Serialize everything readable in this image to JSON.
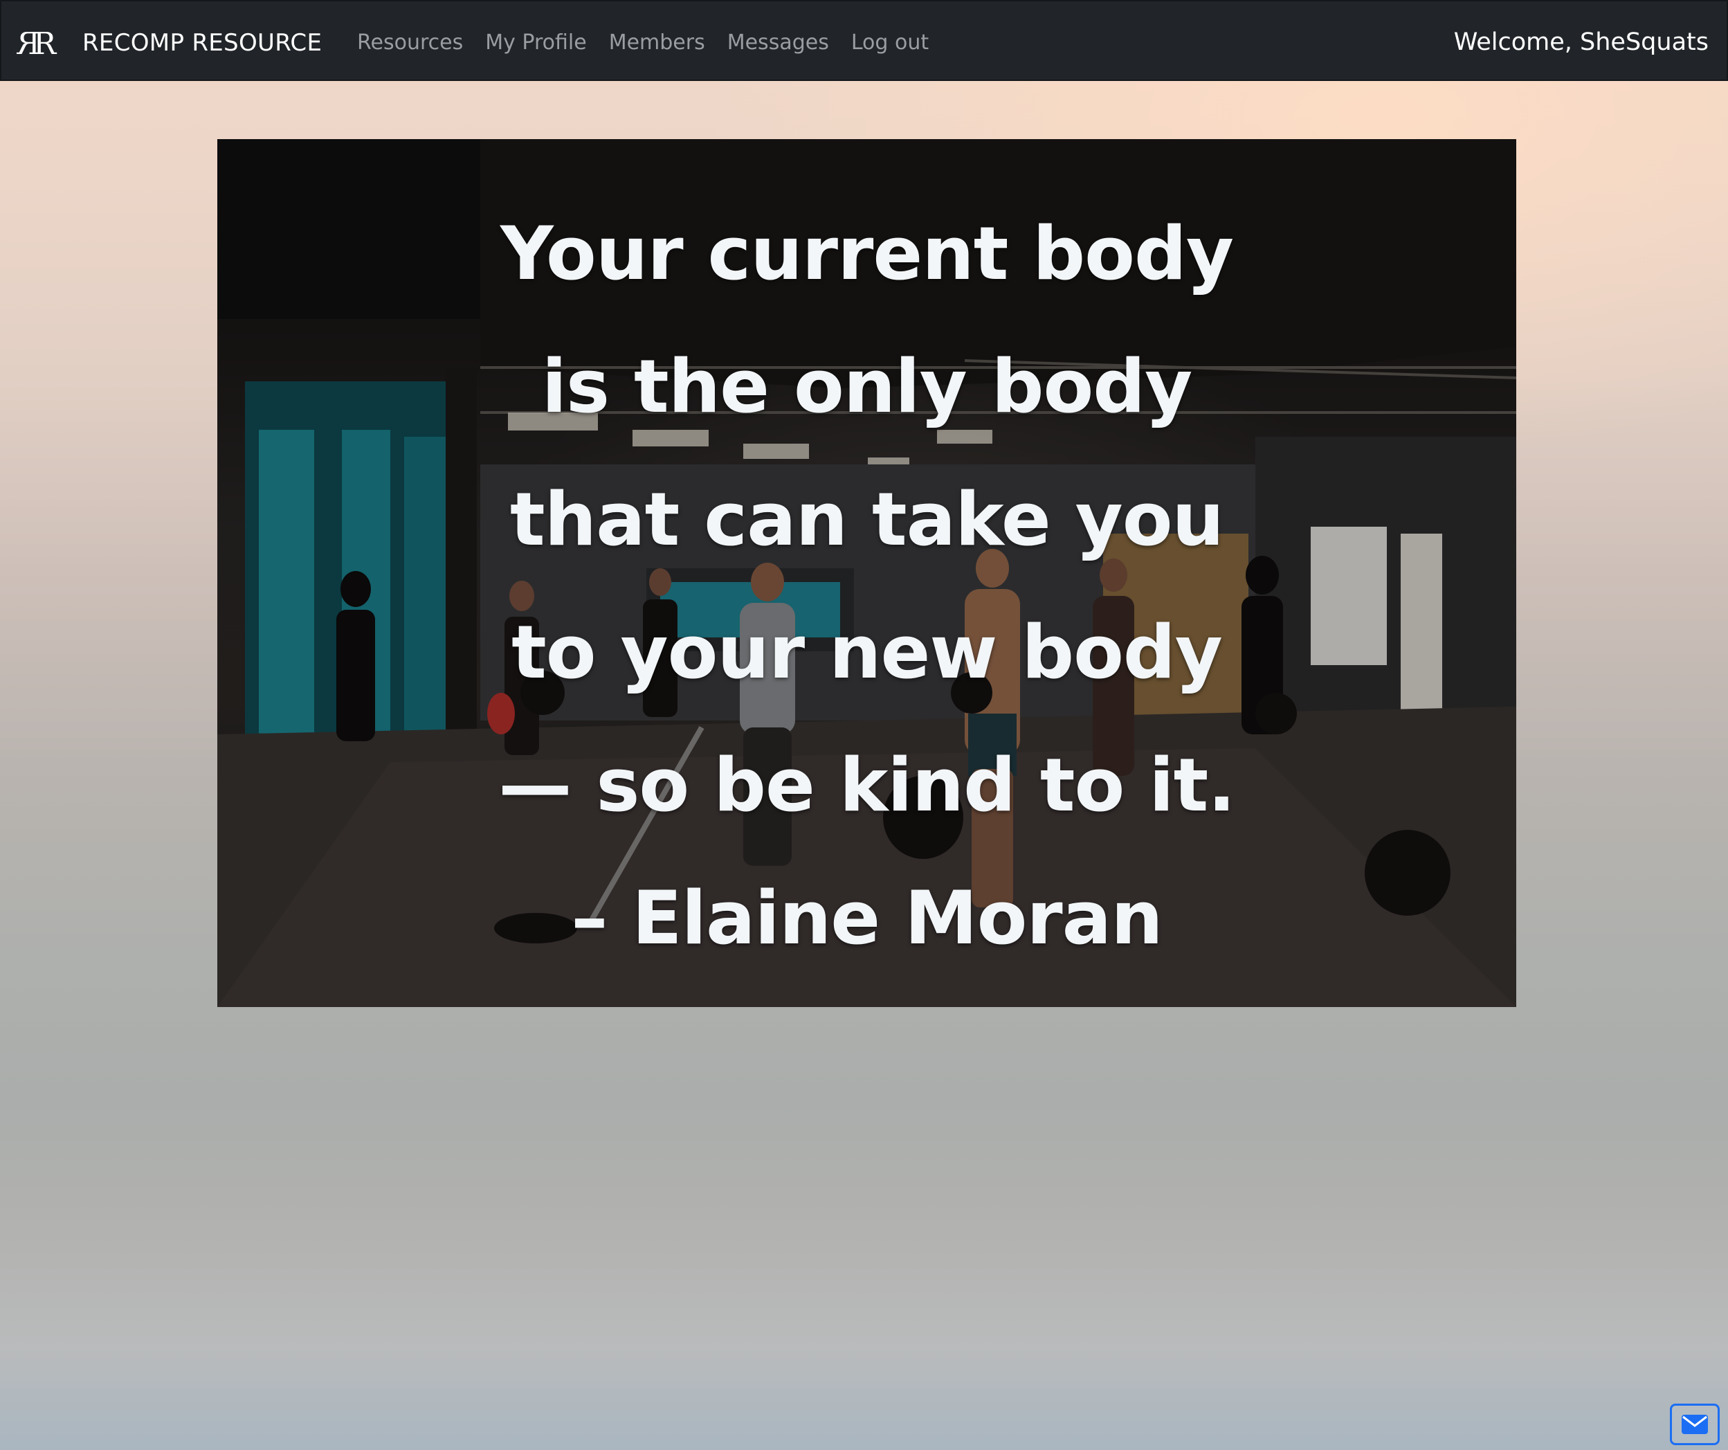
{
  "navbar": {
    "brand": "RECOMP RESOURCE",
    "logo_icon": "rr-monogram-logo",
    "links": [
      "Resources",
      "My Profile",
      "Members",
      "Messages",
      "Log out"
    ],
    "welcome": "Welcome, SheSquats"
  },
  "hero": {
    "image": "gym-crossfit-photo",
    "quote_lines": [
      "Your current body",
      "is the only body",
      "that can take you",
      "to your new body",
      "— so be kind to it.",
      "– Elaine Moran"
    ]
  },
  "floating": {
    "mail_icon": "envelope-icon"
  },
  "colors": {
    "navbar_bg": "#212529",
    "nav_link": "#9a9da1",
    "mail_button": "#1b6ef3",
    "quote_text": "#f3f6f8"
  }
}
